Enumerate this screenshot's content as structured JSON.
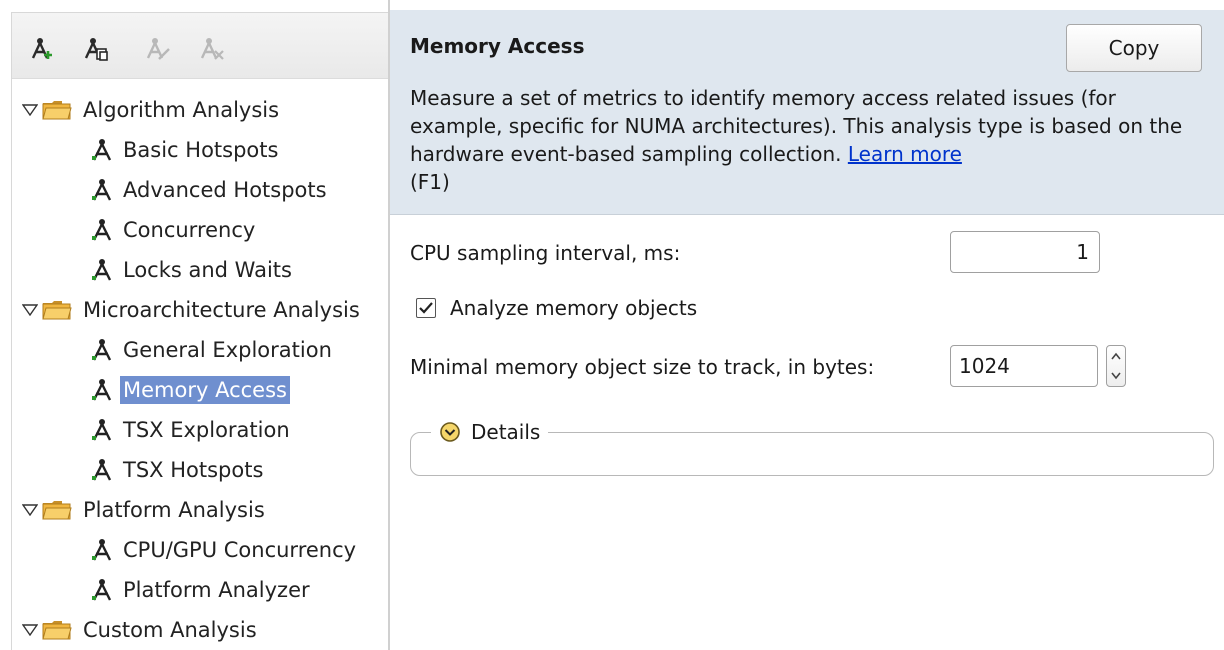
{
  "toolbar": {
    "buttons": [
      {
        "name": "new-analysis-button",
        "icon": "add-analysis-icon",
        "enabled": true
      },
      {
        "name": "copy-analysis-button",
        "icon": "copy-analysis-icon",
        "enabled": true
      },
      {
        "name": "edit-analysis-button",
        "icon": "edit-analysis-icon",
        "enabled": false
      },
      {
        "name": "delete-analysis-button",
        "icon": "delete-analysis-icon",
        "enabled": false
      }
    ]
  },
  "tree": {
    "groups": [
      {
        "label": "Algorithm Analysis",
        "expanded": true,
        "icon": "folder-icon"
      },
      {
        "label": "Microarchitecture Analysis",
        "expanded": true,
        "icon": "folder-icon"
      },
      {
        "label": "Platform Analysis",
        "expanded": true,
        "icon": "folder-icon"
      },
      {
        "label": "Custom Analysis",
        "expanded": true,
        "icon": "folder-icon"
      }
    ],
    "items": [
      {
        "label": "Basic Hotspots",
        "group": 0
      },
      {
        "label": "Advanced Hotspots",
        "group": 0
      },
      {
        "label": "Concurrency",
        "group": 0
      },
      {
        "label": "Locks and Waits",
        "group": 0
      },
      {
        "label": "General Exploration",
        "group": 1
      },
      {
        "label": "Memory Access",
        "group": 1,
        "selected": true
      },
      {
        "label": "TSX Exploration",
        "group": 1
      },
      {
        "label": "TSX Hotspots",
        "group": 1
      },
      {
        "label": "CPU/GPU Concurrency",
        "group": 2
      },
      {
        "label": "Platform Analyzer",
        "group": 2
      }
    ]
  },
  "header": {
    "title": "Memory Access",
    "copy_label": "Copy",
    "description": "Measure a set of metrics to identify memory access related issues (for example, specific for NUMA architectures). This analysis type is based on the hardware event-based sampling collection. ",
    "learn_more": "Learn more",
    "shortcut": " (F1)"
  },
  "form": {
    "cpu_label": "CPU sampling interval, ms:",
    "cpu_value": "1",
    "analyze_label": "Analyze memory objects",
    "analyze_checked": true,
    "minsize_label": "Minimal memory object size to track, in bytes:",
    "minsize_value": "1024",
    "details_label": "Details"
  },
  "colors": {
    "header_bg": "#dfe7ef",
    "selection": "#6f8fcf",
    "link": "#0033cc",
    "folder": "#f0b640"
  }
}
